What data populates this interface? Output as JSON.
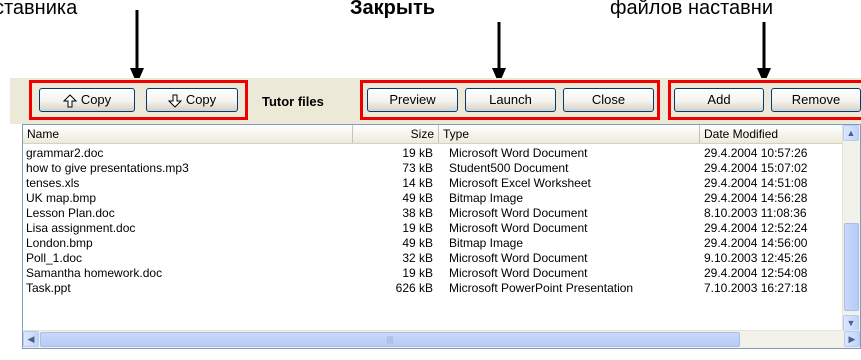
{
  "annotations": {
    "left": "ставника",
    "middle": "Закрыть",
    "right": "файлов наставни"
  },
  "toolbar": {
    "copy_up_label": "Copy",
    "copy_down_label": "Copy",
    "tutor_files_label": "Tutor files",
    "preview_label": "Preview",
    "launch_label": "Launch",
    "close_label": "Close",
    "add_label": "Add",
    "remove_label": "Remove"
  },
  "icons": {
    "copy_up": "arrow-up-icon",
    "copy_down": "arrow-down-icon"
  },
  "colors": {
    "highlight_box": "#ee0000",
    "window_bg": "#ece9d8",
    "scrollbar": "#c1d3fb"
  },
  "file_list": {
    "columns": [
      "Name",
      "Size",
      "Type",
      "Date Modified"
    ],
    "rows": [
      {
        "name": "grammar2.doc",
        "size": "19 kB",
        "type": "Microsoft Word Document",
        "date": "29.4.2004 10:57:26"
      },
      {
        "name": "how to give presentations.mp3",
        "size": "73 kB",
        "type": "Student500 Document",
        "date": "29.4.2004 15:07:02"
      },
      {
        "name": "tenses.xls",
        "size": "14 kB",
        "type": "Microsoft Excel Worksheet",
        "date": "29.4.2004 14:51:08"
      },
      {
        "name": "UK map.bmp",
        "size": "49 kB",
        "type": "Bitmap Image",
        "date": "29.4.2004 14:56:28"
      },
      {
        "name": "Lesson Plan.doc",
        "size": "38 kB",
        "type": "Microsoft Word Document",
        "date": "8.10.2003 11:08:36"
      },
      {
        "name": "Lisa assignment.doc",
        "size": "19 kB",
        "type": "Microsoft Word Document",
        "date": "29.4.2004 12:52:24"
      },
      {
        "name": "London.bmp",
        "size": "49 kB",
        "type": "Bitmap Image",
        "date": "29.4.2004 14:56:00"
      },
      {
        "name": "Poll_1.doc",
        "size": "32 kB",
        "type": "Microsoft Word Document",
        "date": "9.10.2003 12:45:26"
      },
      {
        "name": "Samantha homework.doc",
        "size": "19 kB",
        "type": "Microsoft Word Document",
        "date": "29.4.2004 12:54:08"
      },
      {
        "name": "Task.ppt",
        "size": "626 kB",
        "type": "Microsoft PowerPoint Presentation",
        "date": "7.10.2003 16:27:18"
      }
    ]
  }
}
